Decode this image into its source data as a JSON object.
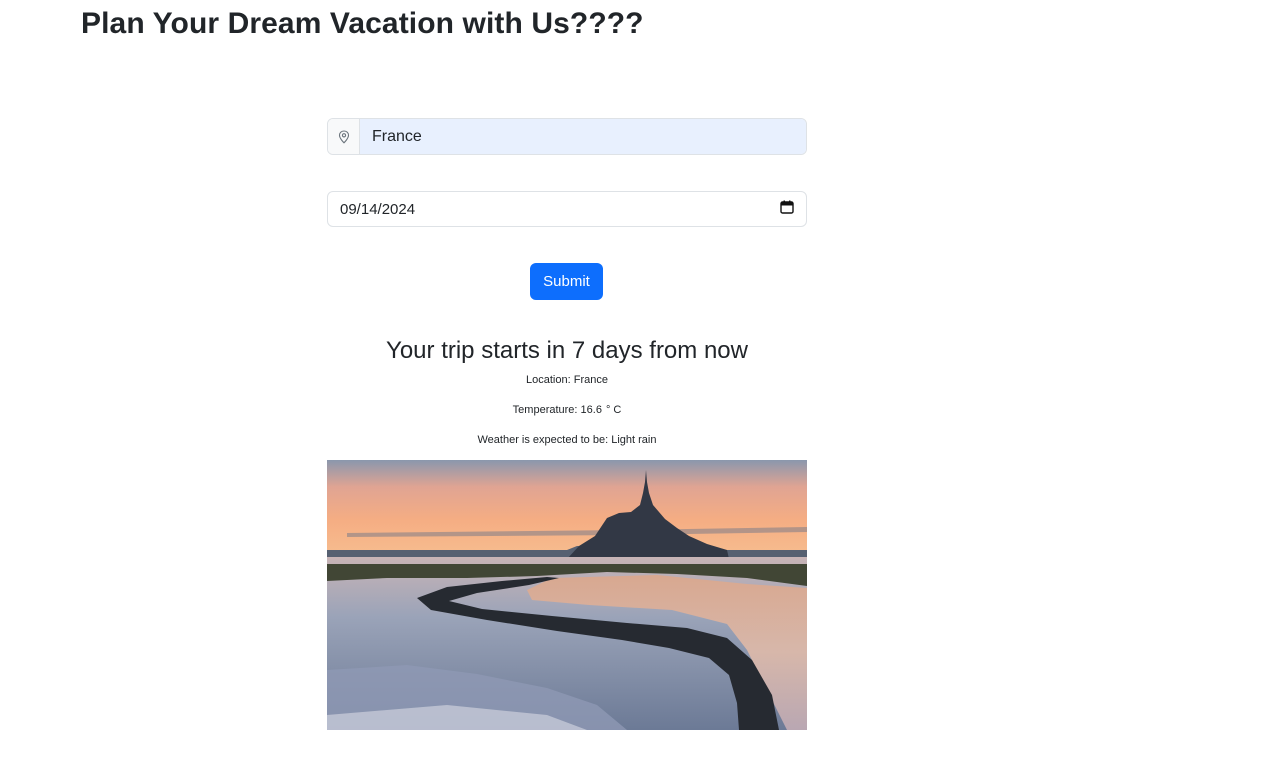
{
  "page": {
    "title": "Plan Your Dream Vacation with Us????"
  },
  "form": {
    "location_icon": "map-pin-icon",
    "location_value": "France",
    "date_value": "09/14/2024",
    "date_icon": "calendar-icon",
    "submit_label": "Submit"
  },
  "result": {
    "heading": "Your trip starts in 7 days from now",
    "location_label": "Location:",
    "location_value": "France",
    "temperature_label": "Temperature:",
    "temperature_value": "16.6",
    "temperature_degree": "°",
    "temperature_unit": "C",
    "weather_label": "Weather is expected to be:",
    "weather_value": "Light rain"
  },
  "image": {
    "subject": "mont-saint-michel-sunset-photo"
  },
  "colors": {
    "primary": "#0d6efd",
    "autofill_bg": "#e8f0fe",
    "border": "#dee2e6",
    "text": "#212529"
  }
}
